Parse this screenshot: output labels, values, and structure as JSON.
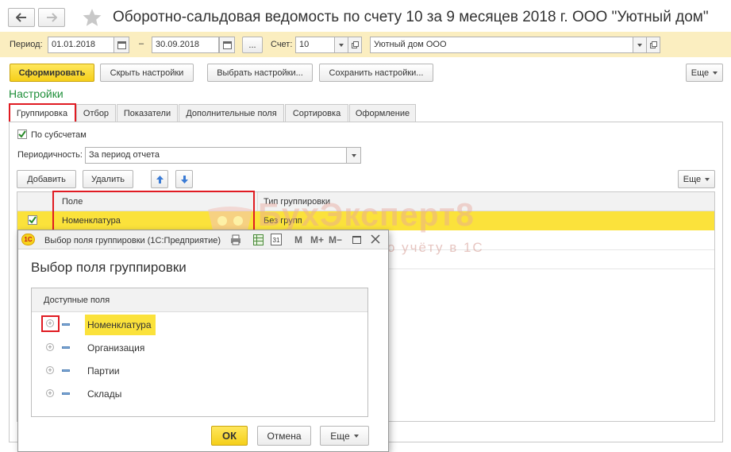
{
  "window": {
    "title": "Оборотно-сальдовая ведомость по счету 10 за 9 месяцев 2018 г. ООО \"Уютный дом\""
  },
  "period": {
    "label": "Период:",
    "from": "01.01.2018",
    "dash": "–",
    "to": "30.09.2018",
    "more": "..."
  },
  "account": {
    "label": "Счет:",
    "value": "10"
  },
  "organization": {
    "value": "Уютный дом ООО"
  },
  "toolbar": {
    "generate": "Сформировать",
    "hide_settings": "Скрыть настройки",
    "choose_settings": "Выбрать настройки...",
    "save_settings": "Сохранить настройки...",
    "more": "Еще"
  },
  "settings": {
    "heading": "Настройки",
    "tabs": [
      "Группировка",
      "Отбор",
      "Показатели",
      "Дополнительные поля",
      "Сортировка",
      "Оформление"
    ],
    "by_subaccounts": "По субсчетам",
    "periodicity_label": "Периодичность:",
    "periodicity_value": "За период отчета",
    "add": "Добавить",
    "delete": "Удалить",
    "more": "Еще",
    "table": {
      "col_field": "Поле",
      "col_type": "Тип группировки",
      "rows": [
        {
          "field": "Номенклатура",
          "type": "Без групп",
          "checked": true
        }
      ]
    }
  },
  "watermark": {
    "brand": "БухЭксперт8",
    "slogan": "База ответов по учёту в 1С"
  },
  "dialog": {
    "app_label": "1С",
    "title": "Выбор поля группировки  (1С:Предприятие)",
    "toolbar_icons": [
      "M",
      "M+",
      "M−"
    ],
    "calendar_day": "31",
    "heading": "Выбор поля группировки",
    "list_header": "Доступные поля",
    "items": [
      "Номенклатура",
      "Организация",
      "Партии",
      "Склады"
    ],
    "ok": "ОК",
    "cancel": "Отмена",
    "more": "Еще"
  },
  "colors": {
    "accent_yellow": "#f5cf1a",
    "selection_yellow": "#fbe23b",
    "highlight_red": "#e01b22",
    "heading_green": "#1f8f3a"
  }
}
